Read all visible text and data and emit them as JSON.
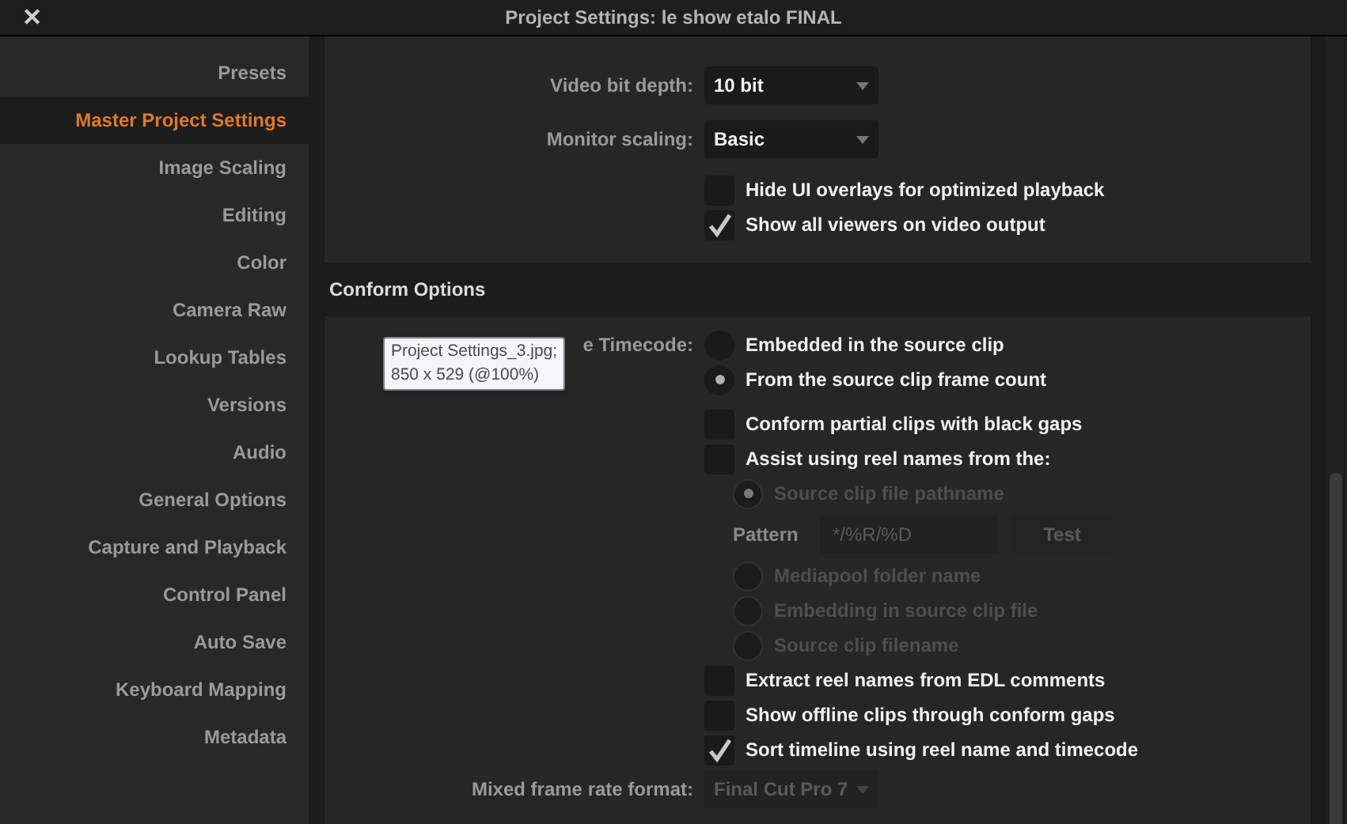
{
  "window": {
    "title": "Project Settings:  le show etalo FINAL",
    "close": "✕"
  },
  "sidebar": {
    "items": [
      {
        "label": "Presets",
        "selected": false
      },
      {
        "label": "Master Project Settings",
        "selected": true
      },
      {
        "label": "Image Scaling",
        "selected": false
      },
      {
        "label": "Editing",
        "selected": false
      },
      {
        "label": "Color",
        "selected": false
      },
      {
        "label": "Camera Raw",
        "selected": false
      },
      {
        "label": "Lookup Tables",
        "selected": false
      },
      {
        "label": "Versions",
        "selected": false
      },
      {
        "label": "Audio",
        "selected": false
      },
      {
        "label": "General Options",
        "selected": false
      },
      {
        "label": "Capture and Playback",
        "selected": false
      },
      {
        "label": "Control Panel",
        "selected": false
      },
      {
        "label": "Auto Save",
        "selected": false
      },
      {
        "label": "Keyboard Mapping",
        "selected": false
      },
      {
        "label": "Metadata",
        "selected": false
      }
    ]
  },
  "video_section": {
    "dropdowns": [
      {
        "label": "Video bit depth:",
        "value": "10 bit"
      },
      {
        "label": "Monitor scaling:",
        "value": "Basic"
      }
    ],
    "checkboxes": [
      {
        "label": "Hide UI overlays for optimized playback",
        "checked": false
      },
      {
        "label": "Show all viewers on video output",
        "checked": true
      }
    ]
  },
  "conform_section": {
    "title": "Conform Options",
    "field_label": "e Timecode:",
    "rows": [
      {
        "kind": "radio",
        "label": "Embedded in the source clip",
        "selected": false,
        "disabled": false
      },
      {
        "kind": "radio",
        "label": "From the source clip frame count",
        "selected": true,
        "disabled": false
      },
      {
        "kind": "checkbox",
        "label": "Conform partial clips with black gaps",
        "checked": false
      },
      {
        "kind": "checkbox",
        "label": "Assist using reel names from the:",
        "checked": false,
        "children": [
          {
            "kind": "radio",
            "label": "Source clip file pathname",
            "selected": true,
            "disabled": true
          },
          {
            "kind": "pattern",
            "label": "Pattern",
            "value": "*/%R/%D",
            "button": "Test",
            "disabled": true
          },
          {
            "kind": "radio",
            "label": "Mediapool folder name",
            "selected": false,
            "disabled": true
          },
          {
            "kind": "radio",
            "label": "Embedding in source clip file",
            "selected": false,
            "disabled": true
          },
          {
            "kind": "radio",
            "label": "Source clip filename",
            "selected": false,
            "disabled": true
          }
        ]
      },
      {
        "kind": "checkbox",
        "label": "Extract reel names from EDL comments",
        "checked": false
      },
      {
        "kind": "checkbox",
        "label": "Show offline clips through conform gaps",
        "checked": false
      },
      {
        "kind": "checkbox",
        "label": "Sort timeline using reel name and timecode",
        "checked": true
      }
    ],
    "mixed_format": {
      "label": "Mixed frame rate format:",
      "value": "Final Cut Pro 7",
      "disabled": true
    }
  },
  "tooltip": {
    "lines": [
      "Project Settings_3.jpg;",
      "850 x 529 (@100%)"
    ]
  }
}
